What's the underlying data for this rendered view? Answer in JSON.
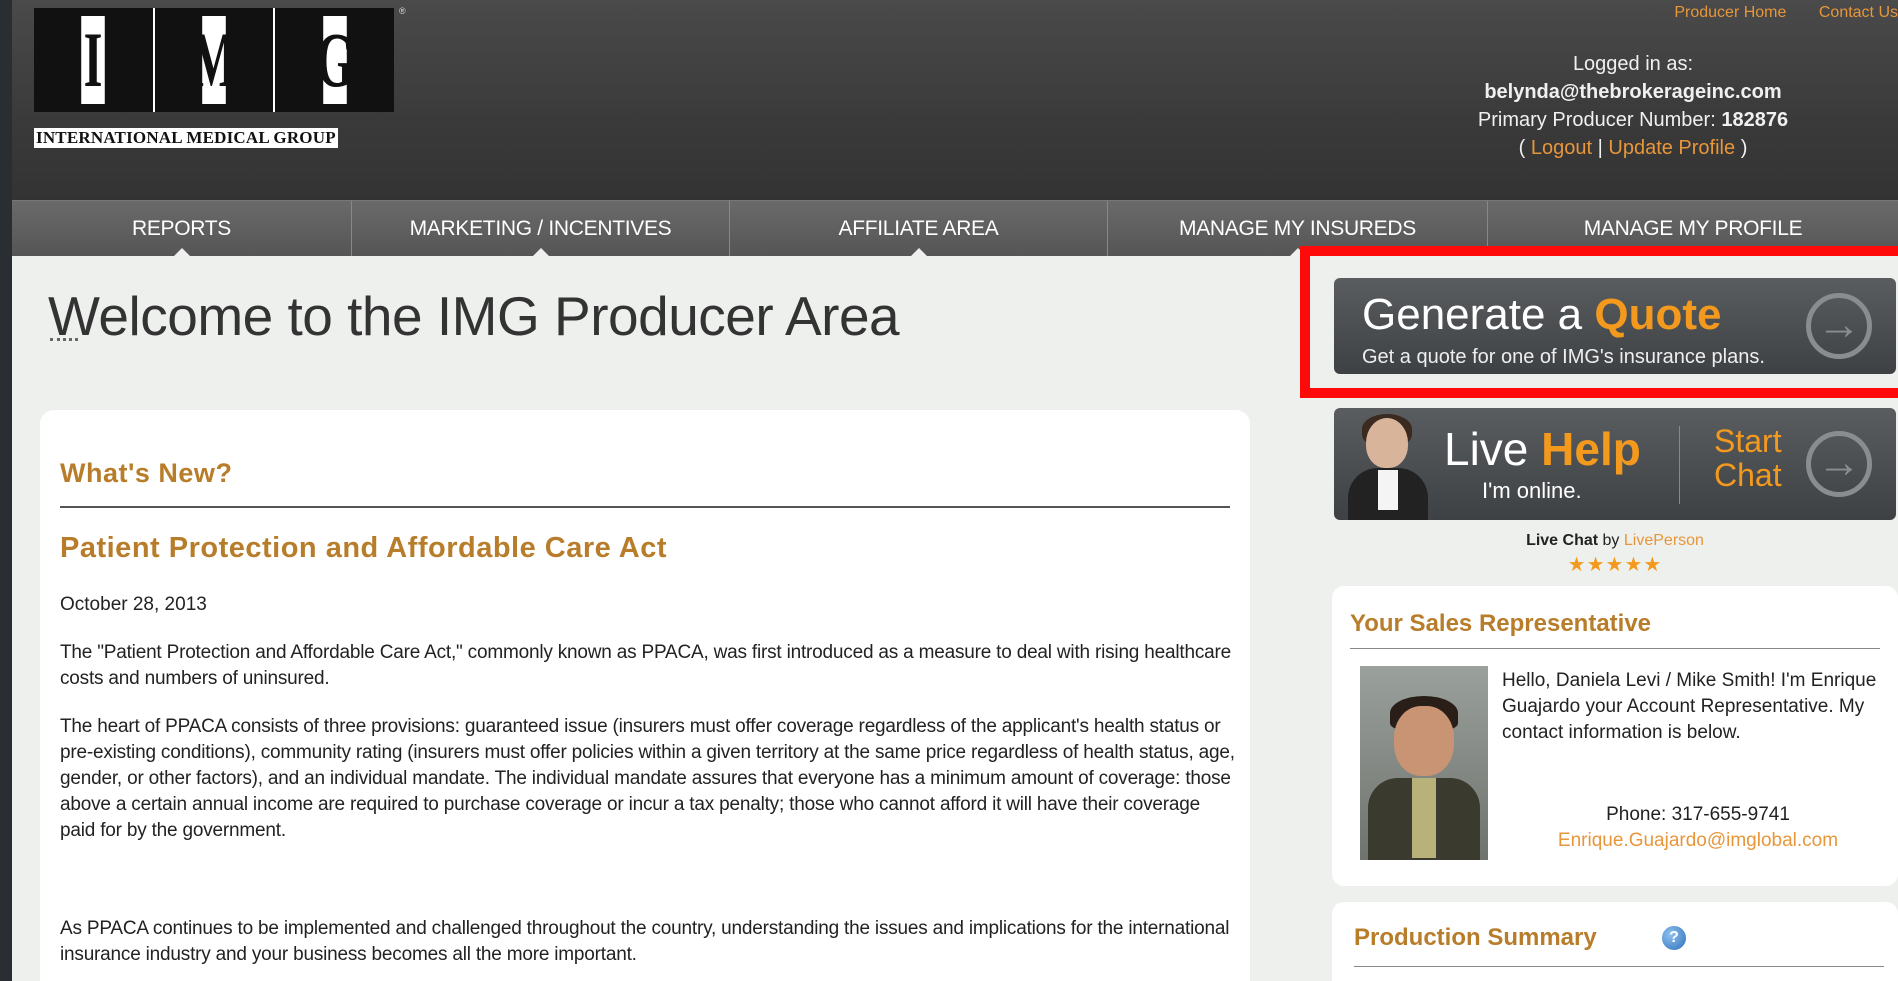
{
  "header": {
    "logo_letters": [
      "I",
      "M",
      "G"
    ],
    "logo_registered": "®",
    "logo_subtitle": "INTERNATIONAL MEDICAL GROUP",
    "top_links": [
      "Producer Home",
      "Contact Us"
    ]
  },
  "login": {
    "label": "Logged in as:",
    "email": "belynda@thebrokerageinc.com",
    "producer_label": "Primary Producer Number:",
    "producer_number": "182876",
    "open_paren": "(",
    "logout": "Logout",
    "separator": "|",
    "update_profile": "Update Profile",
    "close_paren": ")"
  },
  "nav": {
    "items": [
      "Reports",
      "Marketing / Incentives",
      "Affiliate Area",
      "Manage My Insureds",
      "Manage My Profile"
    ]
  },
  "main": {
    "title": "Welcome to the IMG Producer Area"
  },
  "news": {
    "heading": "What's New?",
    "article_title": "Patient Protection and Affordable Care Act",
    "date": "October 28, 2013",
    "paragraphs": [
      "The \"Patient Protection and Affordable Care Act,\" commonly known as PPACA, was first introduced as a measure to deal with rising healthcare costs and numbers of uninsured.",
      "The heart of PPACA consists of three provisions: guaranteed issue (insurers must offer coverage regardless of the applicant's health status or pre-existing conditions), community rating (insurers must offer policies within a given territory at the same price regardless of health status, age, gender, or other factors), and an individual mandate. The individual mandate assures that everyone has a minimum amount of coverage: those above a certain annual income are required to purchase coverage or incur a tax penalty; those who cannot afford it will have their coverage paid for by the government.",
      "As PPACA continues to be implemented and challenged throughout the country, understanding the issues and implications for the international insurance industry and your business becomes all the more important."
    ]
  },
  "quote": {
    "title_prefix": "Generate a",
    "title_accent": "Quote",
    "subtitle": "Get a quote for one of IMG's insurance plans.",
    "highlight_color": "#ff0a0a"
  },
  "live_help": {
    "title_prefix": "Live",
    "title_accent": "Help",
    "status": "I'm online.",
    "start": "Start",
    "chat": "Chat",
    "credit_bold": "Live Chat",
    "credit_by": "by",
    "credit_brand": "LivePerson",
    "rating_stars": 5
  },
  "sales_rep": {
    "heading": "Your Sales Representative",
    "intro": "Hello, Daniela Levi / Mike Smith! I'm Enrique Guajardo your Account Representative. My contact information is below.",
    "phone": "Phone: 317-655-9741",
    "email": "Enrique.Guajardo@imglobal.com"
  },
  "production": {
    "heading": "Production Summary"
  },
  "colors": {
    "accent_orange": "#f39a1e",
    "heading_brown": "#b87d2a",
    "link_orange": "#e8963a"
  }
}
